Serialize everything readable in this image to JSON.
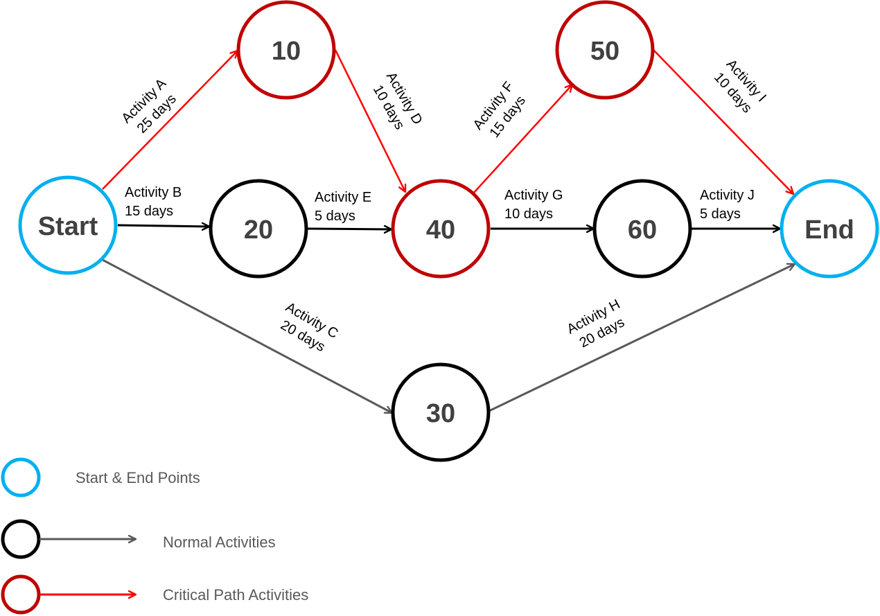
{
  "colors": {
    "start_end": "#00b0f0",
    "normal_node": "#000000",
    "critical_node": "#c00000",
    "normal_arrow_black": "#000000",
    "normal_arrow_gray": "#595959",
    "critical_arrow": "#ff0000",
    "node_text": "#404040",
    "legend_text": "#595959"
  },
  "nodes": [
    {
      "id": "start",
      "label": "Start",
      "type": "start_end"
    },
    {
      "id": "n10",
      "label": "10",
      "type": "critical"
    },
    {
      "id": "n20",
      "label": "20",
      "type": "normal"
    },
    {
      "id": "n30",
      "label": "30",
      "type": "normal"
    },
    {
      "id": "n40",
      "label": "40",
      "type": "critical"
    },
    {
      "id": "n50",
      "label": "50",
      "type": "critical"
    },
    {
      "id": "n60",
      "label": "60",
      "type": "normal"
    },
    {
      "id": "end",
      "label": "End",
      "type": "start_end"
    }
  ],
  "edges": [
    {
      "id": "A",
      "from": "start",
      "to": "n10",
      "activity": "Activity A",
      "duration": "25 days",
      "type": "critical"
    },
    {
      "id": "B",
      "from": "start",
      "to": "n20",
      "activity": "Activity B",
      "duration": "15 days",
      "type": "normal"
    },
    {
      "id": "C",
      "from": "start",
      "to": "n30",
      "activity": "Activity C",
      "duration": "20 days",
      "type": "normal_gray"
    },
    {
      "id": "D",
      "from": "n10",
      "to": "n40",
      "activity": "Activity D",
      "duration": "10 days",
      "type": "critical"
    },
    {
      "id": "E",
      "from": "n20",
      "to": "n40",
      "activity": "Activity E",
      "duration": "5 days",
      "type": "normal"
    },
    {
      "id": "F",
      "from": "n40",
      "to": "n50",
      "activity": "Activity F",
      "duration": "15 days",
      "type": "critical"
    },
    {
      "id": "G",
      "from": "n40",
      "to": "n60",
      "activity": "Activity G",
      "duration": "10 days",
      "type": "normal"
    },
    {
      "id": "H",
      "from": "n30",
      "to": "end",
      "activity": "Activity H",
      "duration": "20 days",
      "type": "normal_gray"
    },
    {
      "id": "I",
      "from": "n50",
      "to": "end",
      "activity": "Activity I",
      "duration": "10 days",
      "type": "critical"
    },
    {
      "id": "J",
      "from": "n60",
      "to": "end",
      "activity": "Activity J",
      "duration": "5 days",
      "type": "normal"
    }
  ],
  "legend": [
    {
      "label": "Start & End Points",
      "type": "start_end"
    },
    {
      "label": "Normal Activities",
      "type": "normal"
    },
    {
      "label": "Critical Path Activities",
      "type": "critical"
    }
  ]
}
